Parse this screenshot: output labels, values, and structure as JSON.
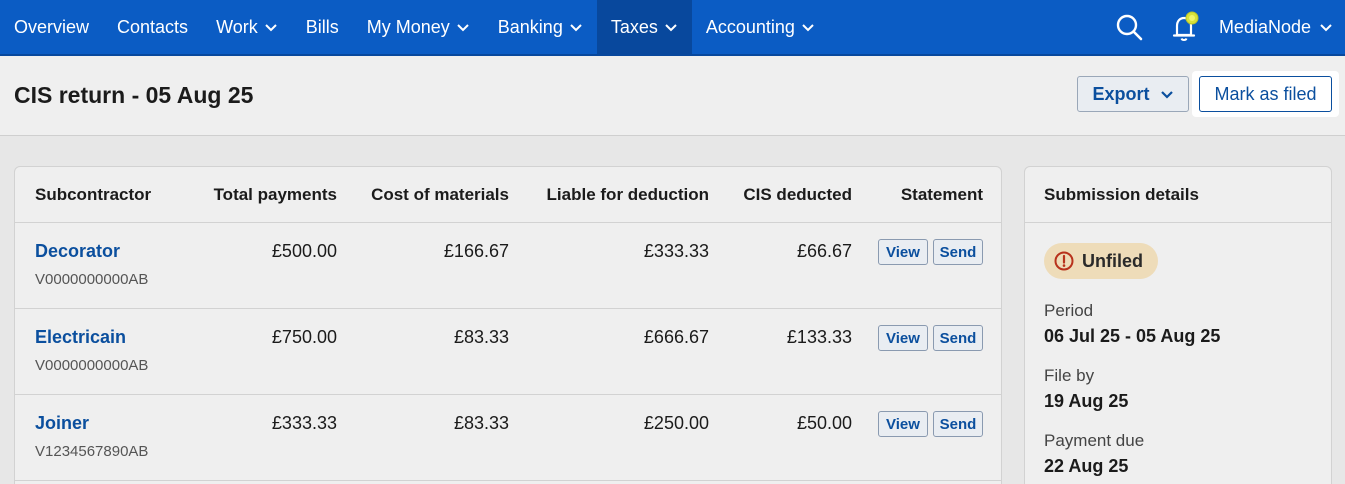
{
  "nav": {
    "items": [
      {
        "label": "Overview",
        "has_menu": false,
        "active": false
      },
      {
        "label": "Contacts",
        "has_menu": false,
        "active": false
      },
      {
        "label": "Work",
        "has_menu": true,
        "active": false
      },
      {
        "label": "Bills",
        "has_menu": false,
        "active": false
      },
      {
        "label": "My Money",
        "has_menu": true,
        "active": false
      },
      {
        "label": "Banking",
        "has_menu": true,
        "active": false
      },
      {
        "label": "Taxes",
        "has_menu": true,
        "active": true
      },
      {
        "label": "Accounting",
        "has_menu": true,
        "active": false
      }
    ],
    "account_label": "MediaNode",
    "icons": [
      "search-icon",
      "notification-bell-icon"
    ],
    "colors": {
      "bar": "#0b5cc4",
      "active": "#08489d",
      "bell_badge": "#d8e23a"
    }
  },
  "header": {
    "title": "CIS return - 05 Aug 25",
    "export_label": "Export",
    "mark_filed_label": "Mark as filed"
  },
  "table": {
    "columns": [
      "Subcontractor",
      "Total payments",
      "Cost of materials",
      "Liable for deduction",
      "CIS deducted",
      "Statement"
    ],
    "rows": [
      {
        "name": "Decorator",
        "utr": "V0000000000AB",
        "total": "£500.00",
        "materials": "£166.67",
        "liable": "£333.33",
        "deducted": "£66.67"
      },
      {
        "name": "Electricain",
        "utr": "V0000000000AB",
        "total": "£750.00",
        "materials": "£83.33",
        "liable": "£666.67",
        "deducted": "£133.33"
      },
      {
        "name": "Joiner",
        "utr": "V1234567890AB",
        "total": "£333.33",
        "materials": "£83.33",
        "liable": "£250.00",
        "deducted": "£50.00"
      }
    ],
    "view_label": "View",
    "send_label": "Send"
  },
  "submission": {
    "title": "Submission details",
    "status": "Unfiled",
    "status_color": "#eedcb9",
    "period_label": "Period",
    "period_value": "06 Jul 25 - 05 Aug 25",
    "file_by_label": "File by",
    "file_by_value": "19 Aug 25",
    "payment_due_label": "Payment due",
    "payment_due_value": "22 Aug 25"
  }
}
